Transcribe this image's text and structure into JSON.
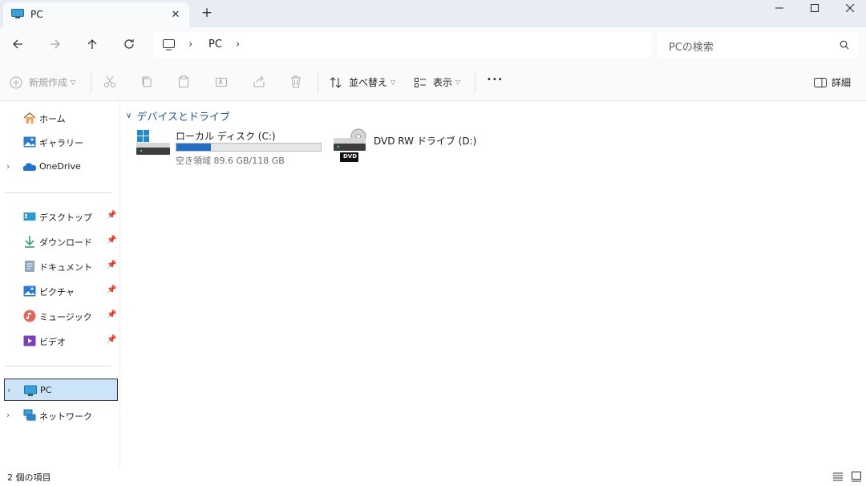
{
  "tab": {
    "title": "PC",
    "close_glyph": "✕",
    "new_tab_glyph": "+"
  },
  "window_controls": {
    "minimize": "—",
    "maximize": "☐",
    "close": "✕"
  },
  "address": {
    "breadcrumb": "PC",
    "sep1": "›",
    "sep2": "›"
  },
  "search": {
    "placeholder": "PCの検索"
  },
  "commands": {
    "new": "新規作成",
    "sort": "並べ替え",
    "view": "表示",
    "more": "•••",
    "details": "詳細"
  },
  "sidebar": {
    "items": [
      {
        "label": "ホーム",
        "icon": "home-icon"
      },
      {
        "label": "ギャラリー",
        "icon": "gallery-icon"
      },
      {
        "label": "OneDrive",
        "icon": "onedrive-icon"
      },
      {
        "label": "デスクトップ",
        "icon": "desktop-icon"
      },
      {
        "label": "ダウンロード",
        "icon": "download-icon"
      },
      {
        "label": "ドキュメント",
        "icon": "document-icon"
      },
      {
        "label": "ピクチャ",
        "icon": "pictures-icon"
      },
      {
        "label": "ミュージック",
        "icon": "music-icon"
      },
      {
        "label": "ビデオ",
        "icon": "video-icon"
      },
      {
        "label": "PC",
        "icon": "pc-icon"
      },
      {
        "label": "ネットワーク",
        "icon": "network-icon"
      }
    ]
  },
  "main": {
    "group_title": "デバイスとドライブ",
    "drives": [
      {
        "name": "ローカル ディスク (C:)",
        "free_text": "空き領域 89.6 GB/118 GB",
        "used_fraction": 0.24
      },
      {
        "name": "DVD RW ドライブ (D:)",
        "badge": "DVD"
      }
    ]
  },
  "status": {
    "item_count": "2 個の項目"
  },
  "colors": {
    "accent": "#1f6fc4",
    "selected_bg": "#cce4f7",
    "titlebar_bg": "#e8edf5"
  }
}
